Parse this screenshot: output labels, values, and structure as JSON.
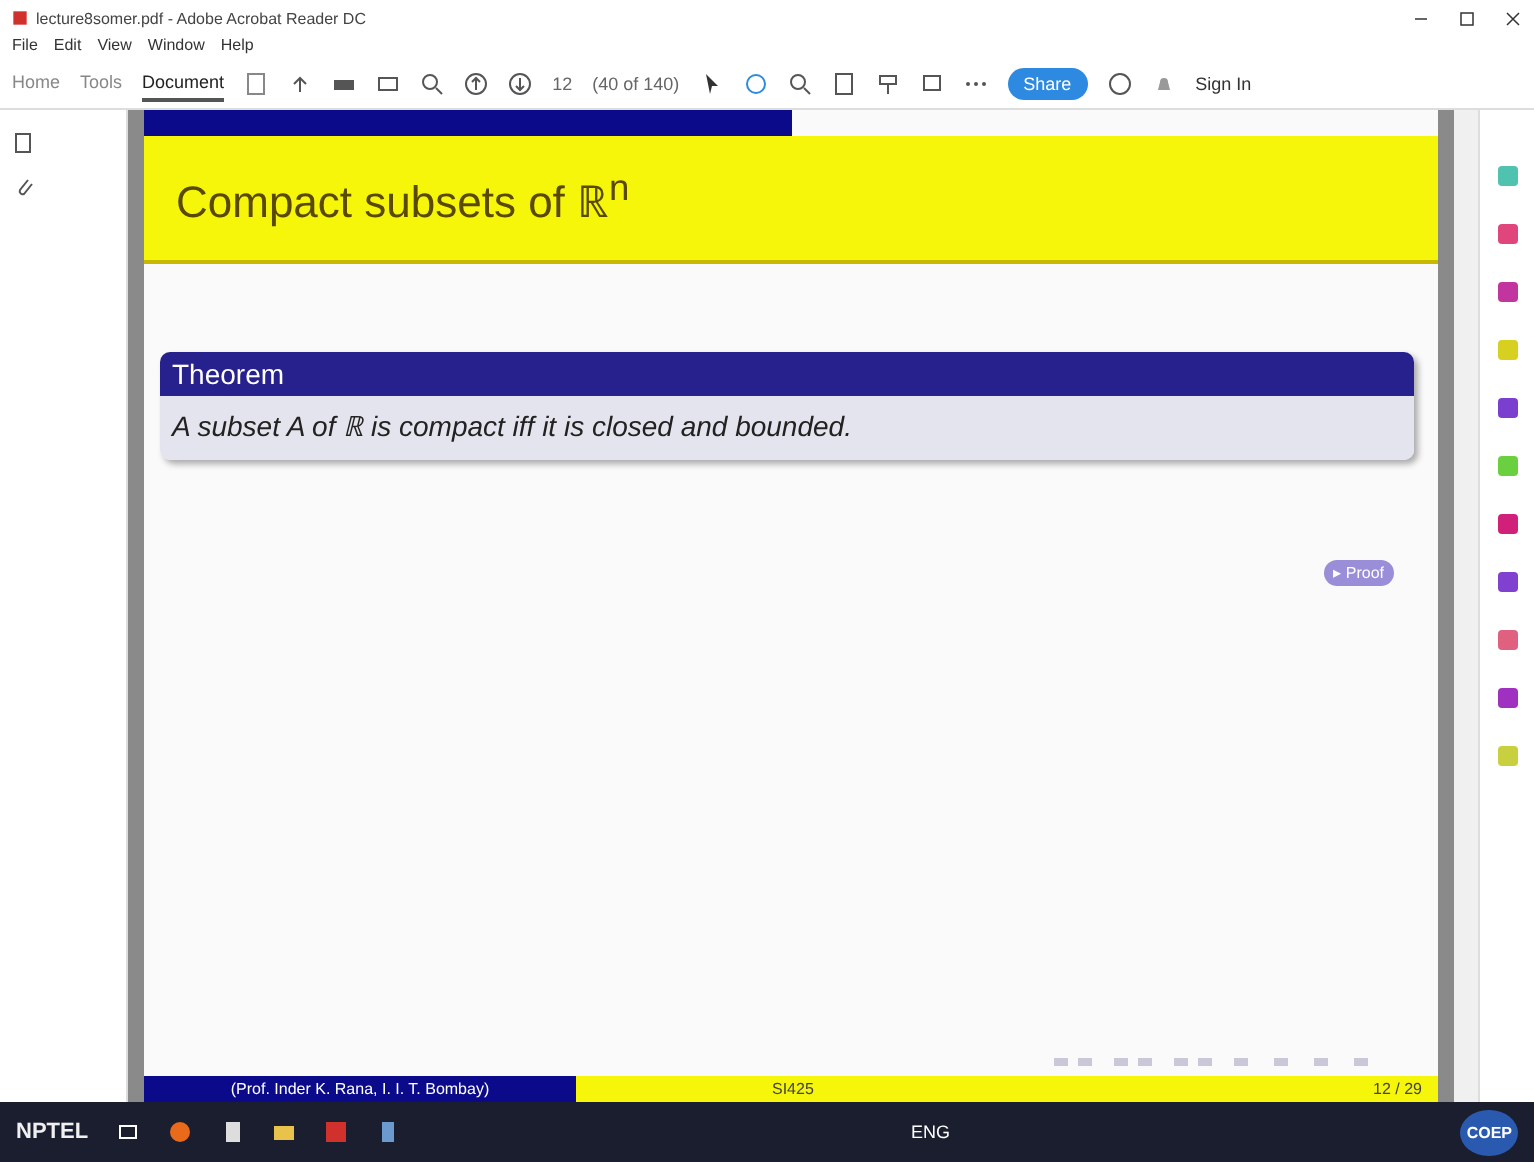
{
  "window": {
    "title": "lecture8somer.pdf - Adobe Acrobat Reader DC"
  },
  "menu": [
    "File",
    "Edit",
    "View",
    "Window",
    "Help"
  ],
  "toolbar": {
    "tabs": [
      {
        "label": "Home",
        "selected": false
      },
      {
        "label": "Tools",
        "selected": false
      },
      {
        "label": "Document",
        "selected": true
      }
    ],
    "page_number": "12",
    "page_count": "(40 of 140)",
    "share": "Share",
    "sign_in": "Sign In"
  },
  "slide": {
    "title": "Compact subsets of ℝ$^{n}$",
    "block": {
      "heading": "Theorem",
      "body": "A subset A of ℝ is compact iff it is closed and bounded."
    },
    "proof_button": "▸ Proof",
    "footer": {
      "author": "(Prof. Inder K. Rana, I. I. T. Bombay)",
      "course": "SI425",
      "page": "12 / 29"
    }
  },
  "right_tools": [
    {
      "color": "#4fc3b0"
    },
    {
      "color": "#e0457b"
    },
    {
      "color": "#c2359e"
    },
    {
      "color": "#d8d020"
    },
    {
      "color": "#7b3fd0"
    },
    {
      "color": "#6ad040"
    },
    {
      "color": "#d0207a"
    },
    {
      "color": "#8040d0"
    },
    {
      "color": "#e06080"
    },
    {
      "color": "#a030c0"
    },
    {
      "color": "#c8d040"
    }
  ],
  "taskbar": {
    "logo": "NPTEL",
    "language": "ENG",
    "badge": "COEP"
  }
}
